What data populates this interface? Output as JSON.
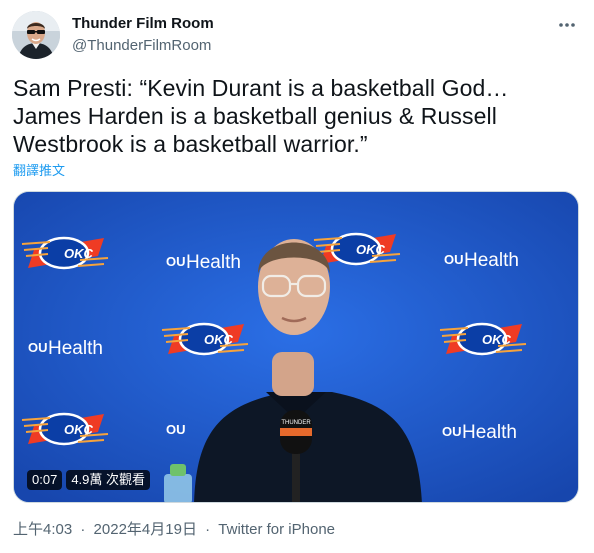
{
  "author": {
    "display_name": "Thunder Film Room",
    "handle": "@ThunderFilmRoom"
  },
  "tweet": {
    "text": "Sam Presti: “Kevin Durant is a basketball God… James Harden is a basketball genius & Russell Westbrook is a basketball warrior.”",
    "translate_label": "翻譯推文"
  },
  "media": {
    "duration": "0:07",
    "views": "4.9萬 次觀看",
    "backdrop_health_label": "Health",
    "backdrop_ou_label": "OU",
    "backdrop_okc_label": "OKC",
    "mic_label": "THUNDER"
  },
  "meta": {
    "time": "上午4:03",
    "separator": "·",
    "date": "2022年4月19日",
    "source": "Twitter for iPhone"
  },
  "icons": {
    "more": "more-horizontal-icon"
  },
  "colors": {
    "link": "#1d9bf0",
    "secondary_text": "#536471",
    "backdrop_blue": "#1e5bd2",
    "okc_orange": "#ef3b24"
  }
}
